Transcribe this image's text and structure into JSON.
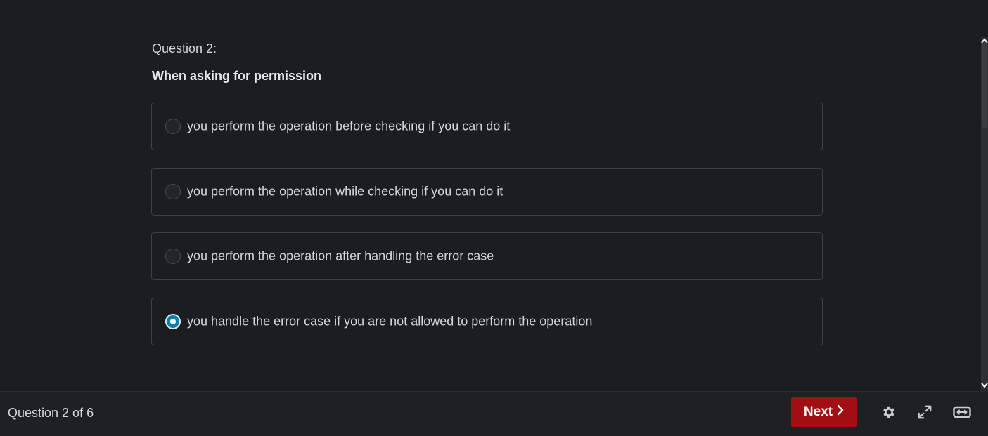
{
  "question": {
    "number_label": "Question 2:",
    "prompt": "When asking for permission",
    "answers": [
      {
        "label": "you perform the operation before checking if you can do it",
        "selected": false
      },
      {
        "label": "you perform the operation while checking if you can do it",
        "selected": false
      },
      {
        "label": "you perform the operation after handling the error case",
        "selected": false
      },
      {
        "label": "you handle the error case if you are not allowed to perform the operation",
        "selected": true
      }
    ]
  },
  "footer": {
    "progress": "Question 2 of 6",
    "next_label": "Next",
    "icons": [
      "gear-icon",
      "expand-icon",
      "theater-mode-icon"
    ]
  },
  "colors": {
    "background": "#1c1d1f",
    "accent_button": "#a10f13",
    "radio_selected": "#0f7fa3"
  }
}
